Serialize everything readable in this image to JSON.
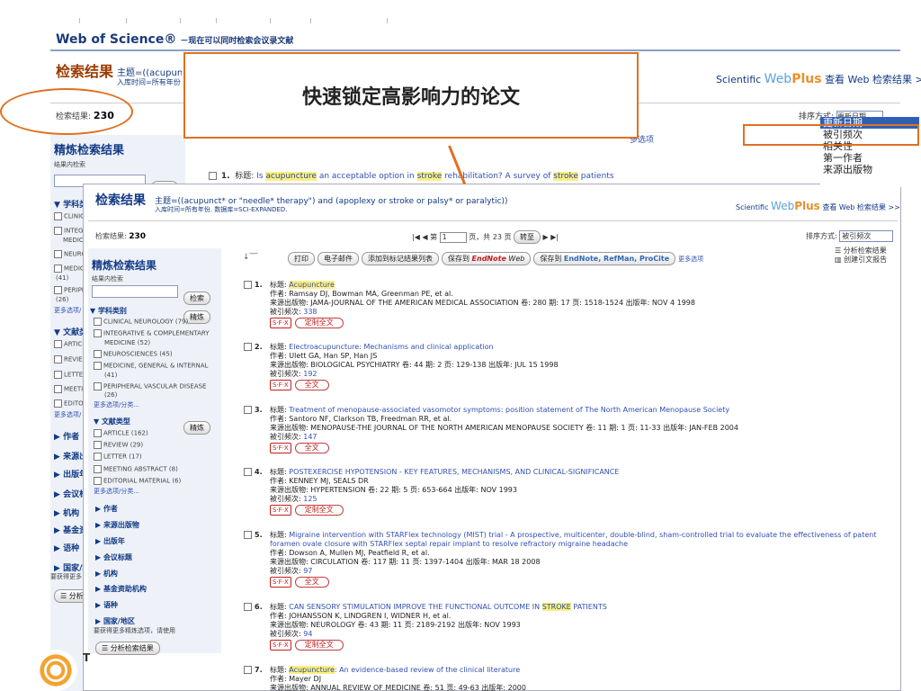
{
  "app": {
    "name": "Web of Science®",
    "subtitle": "－现在可以同时检索会议录文献"
  },
  "background": {
    "search_results_title": "检索结果",
    "topic_line": "主题=((acupunc",
    "time_line": "入库时间=所有年份",
    "count_label": "检索结果:",
    "count_value": "230",
    "sort_label": "排序方式:",
    "sort_value": "更新日期",
    "sciwebplus_text": "查看 Web 检索结果 >>",
    "refine_title": "精炼检索结果",
    "refine_within": "结果内检索",
    "refine_btn": "检索",
    "more_options": "更多选项/",
    "subject_label": "学科类",
    "subjects": [
      "CLINICA",
      "INTEGR",
      "NEUROS",
      "MEDICIN",
      "PERIPHE"
    ],
    "subject_counts": [
      "(41)",
      "(26)"
    ],
    "more_options2": "更多选项/分",
    "doc_label": "文献类",
    "doc_items": [
      "ARTICLE",
      "REVIEW",
      "LETTER",
      "MEETIN",
      "EDITORI"
    ],
    "more_options3": "更多选项/",
    "collapsed": [
      "作者",
      "来源出",
      "出版年",
      "会议标",
      "机构",
      "基金资",
      "语种",
      "国家/地"
    ],
    "analysis_hint": "要获得更多",
    "analysis_btn": "分析",
    "first_result": {
      "num": "1.",
      "title_label": "标题:",
      "t1": "Is",
      "t2": "acupuncture",
      "t3": "an acceptable option in",
      "t4": "stroke",
      "t5": "rehabilitation? A survey of",
      "t6": "stroke",
      "t7": "patients"
    },
    "more_link": "多选项"
  },
  "callout": {
    "text": "快速锁定高影响力的论文"
  },
  "sort_dropdown": {
    "options": [
      "更新日期",
      "被引频次",
      "相关性",
      "第一作者",
      "来源出版物"
    ],
    "selected": "更新日期"
  },
  "overlay": {
    "title": "检索结果",
    "topic": "主题=((acupunct* or \"needle* therapy\") and (apoplexy or stroke or palsy* or paralytic))",
    "time_db": "入库时间=所有年份. 数据库=SCI-EXPANDED.",
    "sciwebplus_text": "查看 Web 检索结果 >>",
    "count_label": "检索结果:",
    "count_value": "230",
    "pager": {
      "first_prev": "|◀ ◀",
      "page_label": "第",
      "page_value": "1",
      "total": "页，共 23 页",
      "go": "转至",
      "next_last": "▶ ▶|"
    },
    "sort_label": "排序方式:",
    "sort_value": "被引频次",
    "refine_title": "精炼检索结果",
    "refine_within": "结果内检索",
    "refine_btn": "检索",
    "refine_btn2": "精炼",
    "subject_label": "学科类别",
    "subjects": [
      "CLINICAL NEUROLOGY (79)",
      "INTEGRATIVE & COMPLEMENTARY",
      "MEDICINE (52)",
      "NEUROSCIENCES (45)",
      "MEDICINE, GENERAL & INTERNAL",
      "(41)",
      "PERIPHERAL VASCULAR DISEASE",
      "(26)"
    ],
    "more_options": "更多选项/分类...",
    "doc_label": "文献类型",
    "doc_btn": "精炼",
    "doc_items": [
      "ARTICLE (162)",
      "REVIEW (29)",
      "LETTER (17)",
      "MEETING ABSTRACT (8)",
      "EDITORIAL MATERIAL (6)"
    ],
    "more_options2": "更多选项/分类...",
    "collapsed": [
      "作者",
      "来源出版物",
      "出版年",
      "会议标题",
      "机构",
      "基金资助机构",
      "语种",
      "国家/地区"
    ],
    "analysis_hint": "要获得更多精炼选项，请使用",
    "analysis_btn": "分析检索结果",
    "actions": [
      "打印",
      "电子邮件",
      "添加到标记结果列表",
      "保存到",
      "保存到"
    ],
    "save_en": "EndNote",
    "save_web": "Web",
    "save_en2": "EndNote, RefMan, ProCite",
    "more_options_link": "更多选项",
    "right_links": [
      "分析检索结果",
      "创建引文报告"
    ],
    "records": [
      {
        "num": "1.",
        "title_label": "标题:",
        "title": "Acupuncture",
        "authors": "作者: Ramsay DJ, Bowman MA, Greenman PE, et al.",
        "source": "来源出版物: JAMA-JOURNAL OF THE AMERICAN MEDICAL ASSOCIATION  卷: 280  期: 17  页: 1518-1524  出版年: NOV 4 1998",
        "cited_label": "被引频次:",
        "cited": "338",
        "btn": "定制全文"
      },
      {
        "num": "2.",
        "title_label": "标题:",
        "title": "Electroacupuncture: Mechanisms and clinical application",
        "authors": "作者: Ulett GA, Han SP, Han JS",
        "source": "来源出版物: BIOLOGICAL PSYCHIATRY  卷: 44  期: 2  页: 129-138  出版年: JUL 15 1998",
        "cited_label": "被引频次:",
        "cited": "192",
        "btn": "全文"
      },
      {
        "num": "3.",
        "title_label": "标题:",
        "title": "Treatment of menopause-associated vasomotor symptoms: position statement of The North American Menopause Society",
        "authors": "作者: Santoro NF, Clarkson TB, Freedman RR, et al.",
        "source": "来源出版物: MENOPAUSE-THE JOURNAL OF THE NORTH AMERICAN MENOPAUSE SOCIETY  卷: 11  期: 1  页: 11-33  出版年: JAN-FEB 2004",
        "cited_label": "被引频次:",
        "cited": "147",
        "btn": "全文"
      },
      {
        "num": "4.",
        "title_label": "标题:",
        "title": "POSTEXERCISE HYPOTENSION - KEY FEATURES, MECHANISMS, AND CLINICAL-SIGNIFICANCE",
        "authors": "作者: KENNEY MJ, SEALS DR",
        "source": "来源出版物: HYPERTENSION  卷: 22  期: 5  页: 653-664  出版年: NOV 1993",
        "cited_label": "被引频次:",
        "cited": "125",
        "btn": "定制全文"
      },
      {
        "num": "5.",
        "title_label": "标题:",
        "title": "Migraine intervention with STARFlex technology (MIST) trial - A prospective, multicenter, double-blind, sham-controlled trial to evaluate the effectiveness of patent foramen ovale closure with STARFlex septal repair implant to resolve refractory migraine headache",
        "authors": "作者: Dowson A, Mullen MJ, Peatfield R, et al.",
        "source": "来源出版物: CIRCULATION  卷: 117  期: 11  页: 1397-1404  出版年: MAR 18 2008",
        "cited_label": "被引频次:",
        "cited": "97",
        "btn": "全文"
      },
      {
        "num": "6.",
        "title_label": "标题:",
        "title_a": "CAN SENSORY STIMULATION IMPROVE THE FUNCTIONAL OUTCOME IN",
        "title_hl": "STROKE",
        "title_b": "PATIENTS",
        "authors": "作者: JOHANSSON K, LINDGREN I, WIDNER H, et al.",
        "source": "来源出版物: NEUROLOGY  卷: 43  期: 11  页: 2189-2192  出版年: NOV 1993",
        "cited_label": "被引频次:",
        "cited": "94",
        "btn": "定制全文"
      },
      {
        "num": "7.",
        "title_label": "标题:",
        "title_hl": "Acupuncture",
        "title_b": ": An evidence-based review of the clinical literature",
        "authors": "作者: Mayer DJ",
        "source": "来源出版物: ANNUAL REVIEW OF MEDICINE  卷: 51  页: 49-63  出版年: 2000"
      }
    ],
    "sfx_label": "S·F·X"
  },
  "logo_text": "T"
}
